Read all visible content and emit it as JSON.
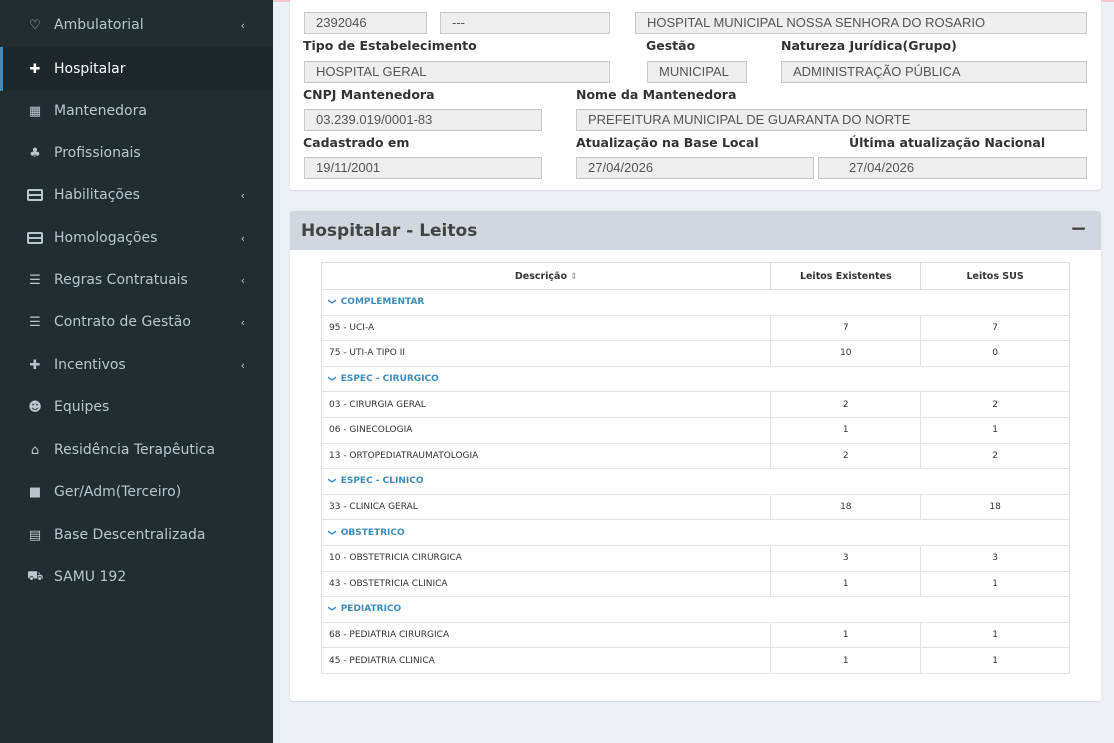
{
  "sidebar": {
    "items": [
      {
        "label": "Ambulatorial",
        "icon": "stethoscope-icon",
        "glyph": "♡",
        "chevron": "‹"
      },
      {
        "label": "Hospitalar",
        "icon": "hospital-icon",
        "glyph": "✚",
        "active": true
      },
      {
        "label": "Mantenedora",
        "icon": "building-icon",
        "glyph": "▦"
      },
      {
        "label": "Profissionais",
        "icon": "users-icon",
        "glyph": "♣"
      },
      {
        "label": "Habilitações",
        "icon": "credit-card-icon",
        "chevron": "‹"
      },
      {
        "label": "Homologações",
        "icon": "credit-card-icon",
        "chevron": "‹"
      },
      {
        "label": "Regras Contratuais",
        "icon": "list-icon",
        "glyph": "☰",
        "chevron": "‹"
      },
      {
        "label": "Contrato de Gestão",
        "icon": "list-icon",
        "glyph": "☰",
        "chevron": "‹"
      },
      {
        "label": "Incentivos",
        "icon": "plus-icon",
        "glyph": "✚",
        "chevron": "‹"
      },
      {
        "label": "Equipes",
        "icon": "group-icon",
        "glyph": "☻"
      },
      {
        "label": "Residência Terapêutica",
        "icon": "home-icon",
        "glyph": "⌂"
      },
      {
        "label": "Ger/Adm(Terceiro)",
        "icon": "building-icon",
        "glyph": "■"
      },
      {
        "label": "Base Descentralizada",
        "icon": "list-alt-icon",
        "glyph": "▤"
      },
      {
        "label": "SAMU 192",
        "icon": "ambulance-icon",
        "glyph": "⛟"
      }
    ]
  },
  "info": {
    "cnes": "2392046",
    "dashes": "---",
    "hospital_name": "HOSPITAL MUNICIPAL NOSSA SENHORA DO ROSARIO",
    "tipo_label": "Tipo de Estabelecimento",
    "tipo_value": "HOSPITAL GERAL",
    "gestao_label": "Gestão",
    "gestao_value": "MUNICIPAL",
    "natureza_label": "Natureza Jurídica(Grupo)",
    "natureza_value": "ADMINISTRAÇÃO PÚBLICA",
    "cnpj_label": "CNPJ Mantenedora",
    "cnpj_value": "03.239.019/0001-83",
    "mant_label": "Nome da Mantenedora",
    "mant_value": "PREFEITURA MUNICIPAL DE GUARANTA DO NORTE",
    "cadastro_label": "Cadastrado em",
    "cadastro_value": "19/11/2001",
    "atual_local_label": "Atualização na Base Local",
    "atual_local_value": "27/04/2026",
    "atual_nac_label": "Última atualização Nacional",
    "atual_nac_value": "27/04/2026"
  },
  "leitos": {
    "title": "Hospitalar - Leitos",
    "collapse": "−",
    "columns": {
      "descricao": "Descrição",
      "sort_glyph": "⇕",
      "existentes": "Leitos Existentes",
      "sus": "Leitos SUS"
    },
    "groups": [
      {
        "name": "COMPLEMENTAR",
        "rows": [
          {
            "desc": "95 - UCI-A",
            "existentes": "7",
            "sus": "7"
          },
          {
            "desc": "75 - UTI-A TIPO II",
            "existentes": "10",
            "sus": "0"
          }
        ]
      },
      {
        "name": "ESPEC - CIRURGICO",
        "rows": [
          {
            "desc": "03 - CIRURGIA GERAL",
            "existentes": "2",
            "sus": "2"
          },
          {
            "desc": "06 - GINECOLOGIA",
            "existentes": "1",
            "sus": "1"
          },
          {
            "desc": "13 - ORTOPEDIATRAUMATOLOGIA",
            "existentes": "2",
            "sus": "2"
          }
        ]
      },
      {
        "name": "ESPEC - CLINICO",
        "rows": [
          {
            "desc": "33 - CLINICA GERAL",
            "existentes": "18",
            "sus": "18"
          }
        ]
      },
      {
        "name": "OBSTETRICO",
        "rows": [
          {
            "desc": "10 - OBSTETRICIA CIRURGICA",
            "existentes": "3",
            "sus": "3"
          },
          {
            "desc": "43 - OBSTETRICIA CLINICA",
            "existentes": "1",
            "sus": "1"
          }
        ]
      },
      {
        "name": "PEDIATRICO",
        "rows": [
          {
            "desc": "68 - PEDIATRIA CIRURGICA",
            "existentes": "1",
            "sus": "1"
          },
          {
            "desc": "45 - PEDIATRIA CLINICA",
            "existentes": "1",
            "sus": "1"
          }
        ]
      }
    ],
    "group_glyph": "❯"
  },
  "colors": {
    "sidebar_bg": "#222d32",
    "active_bg": "#1e282c",
    "accent": "#3c8dbc",
    "page_bg": "#ecf0f5"
  }
}
